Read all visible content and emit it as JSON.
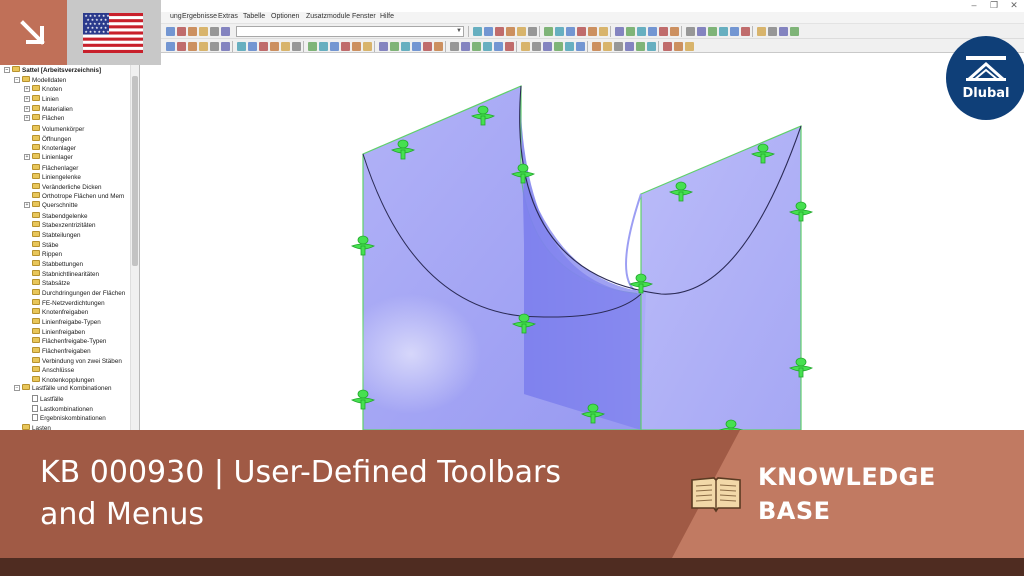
{
  "window": {
    "restore_glyph": "❐",
    "close_glyph": "✕"
  },
  "menu": {
    "items": [
      "ung",
      "Ergebnisse",
      "Extras",
      "Tabelle",
      "Optionen",
      "Zusatzmodule",
      "Fenster",
      "Hilfe"
    ]
  },
  "toolbar": {
    "combo_value": ""
  },
  "navigator": {
    "items": [
      {
        "label": "Sattel [Arbeitsverzeichnis]",
        "level": 0,
        "type": "root",
        "expander": "−"
      },
      {
        "label": "Modelldaten",
        "level": 1,
        "type": "folder",
        "expander": "−"
      },
      {
        "label": "Knoten",
        "level": 2,
        "type": "folder",
        "expander": "+"
      },
      {
        "label": "Linien",
        "level": 2,
        "type": "folder",
        "expander": "+"
      },
      {
        "label": "Materialien",
        "level": 2,
        "type": "folder",
        "expander": "+"
      },
      {
        "label": "Flächen",
        "level": 2,
        "type": "folder",
        "expander": "+"
      },
      {
        "label": "Volumenkörper",
        "level": 2,
        "type": "folder",
        "expander": ""
      },
      {
        "label": "Öffnungen",
        "level": 2,
        "type": "folder",
        "expander": ""
      },
      {
        "label": "Knotenlager",
        "level": 2,
        "type": "folder",
        "expander": ""
      },
      {
        "label": "Linienlager",
        "level": 2,
        "type": "folder",
        "expander": "+"
      },
      {
        "label": "Flächenlager",
        "level": 2,
        "type": "folder",
        "expander": ""
      },
      {
        "label": "Liniengelenke",
        "level": 2,
        "type": "folder",
        "expander": ""
      },
      {
        "label": "Veränderliche Dicken",
        "level": 2,
        "type": "folder",
        "expander": ""
      },
      {
        "label": "Orthotrope Flächen und Mem",
        "level": 2,
        "type": "folder",
        "expander": ""
      },
      {
        "label": "Querschnitte",
        "level": 2,
        "type": "folder",
        "expander": "+"
      },
      {
        "label": "Stabendgelenke",
        "level": 2,
        "type": "folder",
        "expander": ""
      },
      {
        "label": "Stabexzentrizitäten",
        "level": 2,
        "type": "folder",
        "expander": ""
      },
      {
        "label": "Stabteilungen",
        "level": 2,
        "type": "folder",
        "expander": ""
      },
      {
        "label": "Stäbe",
        "level": 2,
        "type": "folder",
        "expander": ""
      },
      {
        "label": "Rippen",
        "level": 2,
        "type": "folder",
        "expander": ""
      },
      {
        "label": "Stabbettungen",
        "level": 2,
        "type": "folder",
        "expander": ""
      },
      {
        "label": "Stabnichtlinearitäten",
        "level": 2,
        "type": "folder",
        "expander": ""
      },
      {
        "label": "Stabsätze",
        "level": 2,
        "type": "folder",
        "expander": ""
      },
      {
        "label": "Durchdringungen der Flächen",
        "level": 2,
        "type": "folder",
        "expander": ""
      },
      {
        "label": "FE-Netzverdichtungen",
        "level": 2,
        "type": "folder",
        "expander": ""
      },
      {
        "label": "Knotenfreigaben",
        "level": 2,
        "type": "folder",
        "expander": ""
      },
      {
        "label": "Linienfreigabe-Typen",
        "level": 2,
        "type": "folder",
        "expander": ""
      },
      {
        "label": "Linienfreigaben",
        "level": 2,
        "type": "folder",
        "expander": ""
      },
      {
        "label": "Flächenfreigabe-Typen",
        "level": 2,
        "type": "folder",
        "expander": ""
      },
      {
        "label": "Flächenfreigaben",
        "level": 2,
        "type": "folder",
        "expander": ""
      },
      {
        "label": "Verbindung von zwei Stäben",
        "level": 2,
        "type": "folder",
        "expander": ""
      },
      {
        "label": "Anschlüsse",
        "level": 2,
        "type": "folder",
        "expander": ""
      },
      {
        "label": "Knotenkopplungen",
        "level": 2,
        "type": "folder",
        "expander": ""
      },
      {
        "label": "Lastfälle und Kombinationen",
        "level": 1,
        "type": "folder",
        "expander": "−"
      },
      {
        "label": "Lastfälle",
        "level": 2,
        "type": "doc",
        "expander": ""
      },
      {
        "label": "Lastkombinationen",
        "level": 2,
        "type": "doc",
        "expander": ""
      },
      {
        "label": "Ergebniskombinationen",
        "level": 2,
        "type": "doc",
        "expander": ""
      },
      {
        "label": "Lasten",
        "level": 1,
        "type": "folder",
        "expander": ""
      }
    ]
  },
  "overlay": {
    "language": "United States flag",
    "arrow_icon": "diagonal-arrow-icon"
  },
  "logo": {
    "text": "Dlubal"
  },
  "banner": {
    "title_line1": "KB 000930 | User-Defined Toolbars",
    "title_line2": "and Menus",
    "label_line1": "KNOWLEDGE",
    "label_line2": "BASE",
    "book_icon": "book-icon"
  },
  "colors": {
    "banner_left": "#a05a45",
    "banner_right": "#c17a62",
    "banner_bottom": "#4f2c21",
    "logo": "#0f3f78",
    "surface": "#8a8cf0",
    "support": "#46e050"
  }
}
